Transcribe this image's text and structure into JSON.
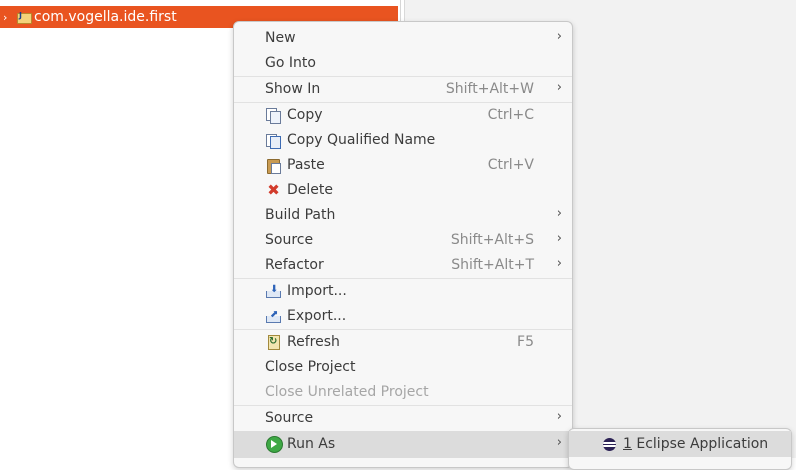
{
  "explorer": {
    "project": "com.vogella.ide.first"
  },
  "menu": {
    "items": [
      {
        "label": "New",
        "accel": "",
        "submenu": true
      },
      {
        "label": "Go Into",
        "accel": "",
        "submenu": false
      },
      {
        "label": "Show In",
        "accel": "Shift+Alt+W",
        "submenu": true
      },
      {
        "label": "Copy",
        "accel": "Ctrl+C",
        "icon": "copy-icon"
      },
      {
        "label": "Copy Qualified Name",
        "accel": "",
        "icon": "copy-qualified-name-icon"
      },
      {
        "label": "Paste",
        "accel": "Ctrl+V",
        "icon": "paste-icon"
      },
      {
        "label": "Delete",
        "accel": "",
        "icon": "delete-icon"
      },
      {
        "label": "Build Path",
        "accel": "",
        "submenu": true
      },
      {
        "label": "Source",
        "accel": "Shift+Alt+S",
        "submenu": true
      },
      {
        "label": "Refactor",
        "accel": "Shift+Alt+T",
        "submenu": true
      },
      {
        "label": "Import...",
        "accel": "",
        "icon": "import-icon"
      },
      {
        "label": "Export...",
        "accel": "",
        "icon": "export-icon"
      },
      {
        "label": "Refresh",
        "accel": "F5",
        "icon": "refresh-icon"
      },
      {
        "label": "Close Project",
        "accel": ""
      },
      {
        "label": "Close Unrelated Project",
        "accel": "",
        "disabled": true
      },
      {
        "label": "Source",
        "accel": "",
        "submenu": true
      },
      {
        "label": "Run As",
        "accel": "",
        "submenu": true,
        "icon": "run-icon",
        "highlighted": true
      }
    ]
  },
  "submenu": {
    "mnemonic": "1",
    "label": " Eclipse Application",
    "icon": "eclipse-icon"
  },
  "colors": {
    "selection": "#e95420",
    "menu_bg": "#f7f7f7",
    "hover": "#dcdcdc"
  }
}
